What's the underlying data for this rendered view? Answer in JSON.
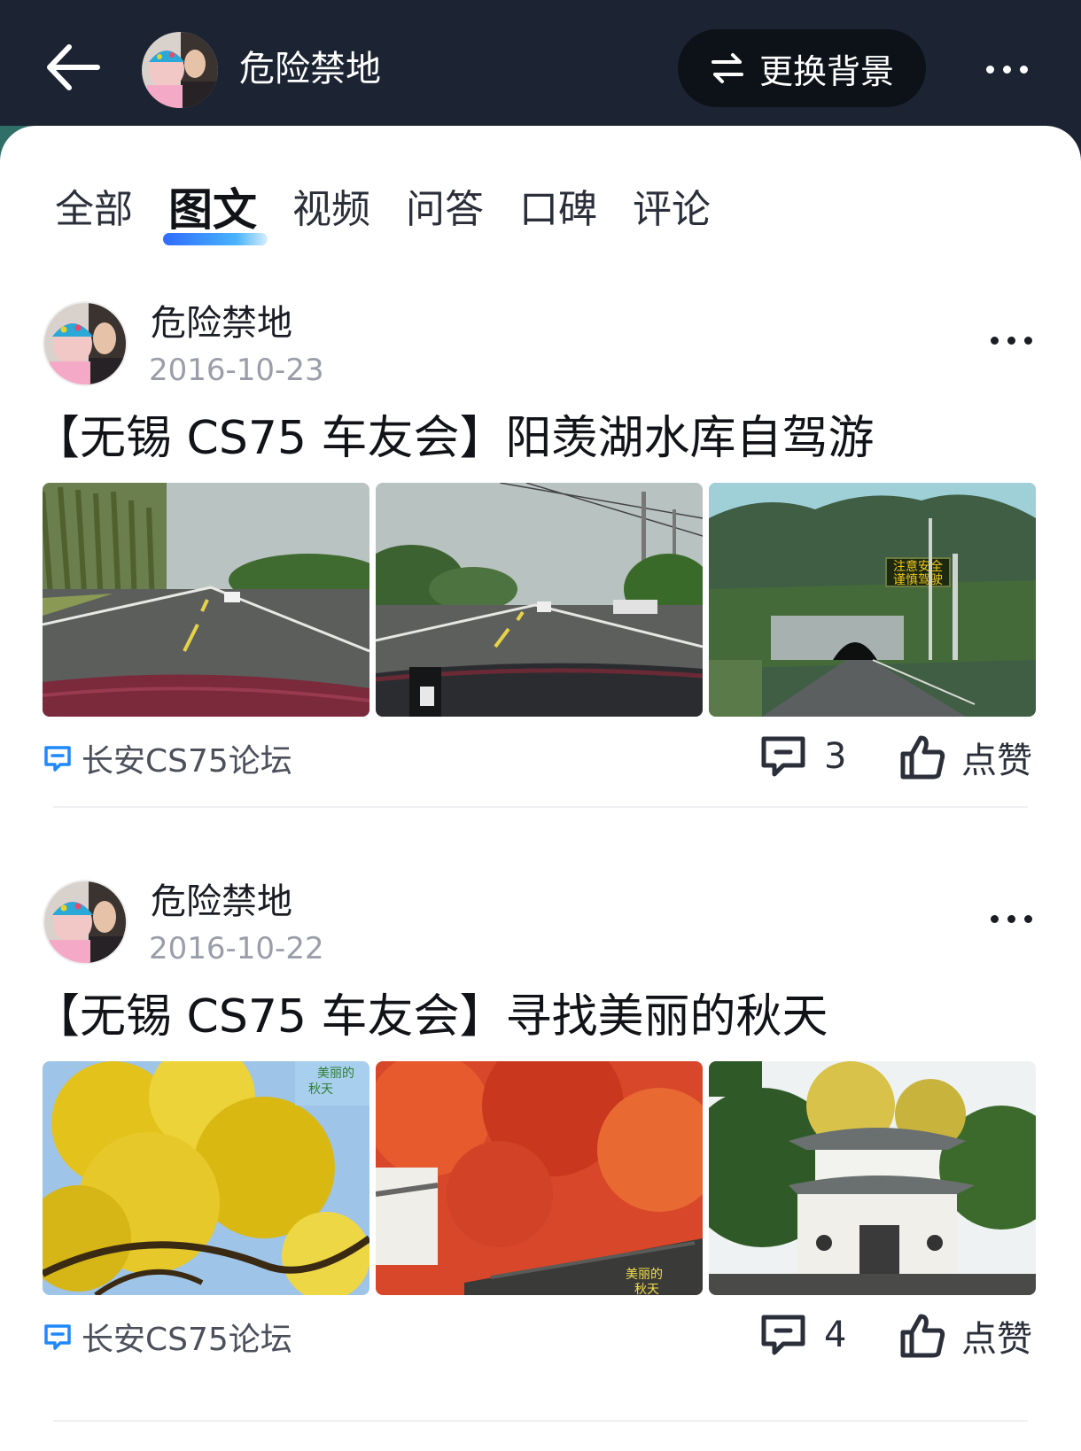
{
  "header": {
    "user_name": "危险禁地",
    "bg_button_label": "更换背景"
  },
  "tabs": [
    {
      "label": "全部",
      "active": false
    },
    {
      "label": "图文",
      "active": true
    },
    {
      "label": "视频",
      "active": false
    },
    {
      "label": "问答",
      "active": false
    },
    {
      "label": "口碑",
      "active": false
    },
    {
      "label": "评论",
      "active": false
    }
  ],
  "posts": [
    {
      "author": "危险禁地",
      "date": "2016-10-23",
      "title": "【无锡 CS75 车友会】阳羡湖水库自驾游",
      "photos": [
        "road-photo",
        "road-photo",
        "tunnel-photo"
      ],
      "sign_text_1": "注意安全",
      "sign_text_2": "谨慎驾驶",
      "forum": "长安CS75论坛",
      "comments": "3",
      "like_label": "点赞"
    },
    {
      "author": "危险禁地",
      "date": "2016-10-22",
      "title": "【无锡 CS75 车友会】寻找美丽的秋天",
      "photos": [
        "ginkgo-photo",
        "maple-photo",
        "pavilion-photo"
      ],
      "overlay_text_1": "美丽的",
      "overlay_text_2": "秋天",
      "forum": "长安CS75论坛",
      "comments": "4",
      "like_label": "点赞"
    }
  ],
  "colors": {
    "header_bg": "#1c2433",
    "accent_blue": "#2f6bff",
    "forum_icon": "#1e88ff"
  }
}
